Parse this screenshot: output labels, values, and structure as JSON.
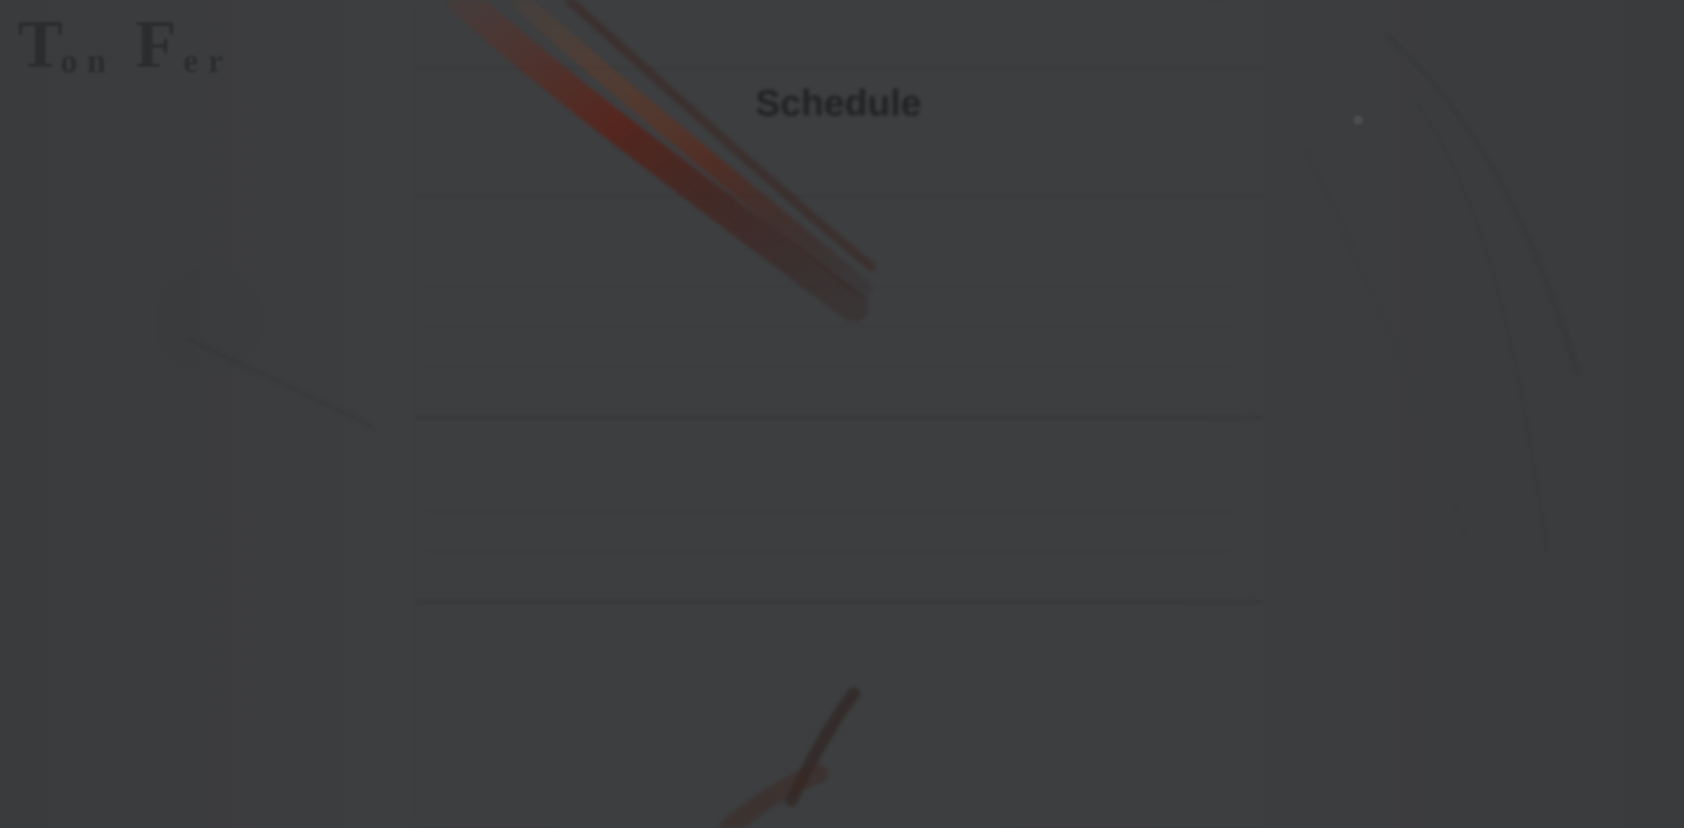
{
  "window": {
    "logo_text": "",
    "top_left_link": "",
    "top_right_link": ""
  },
  "schedule": {
    "title": "Schedule",
    "subtitle": "",
    "days": [
      {
        "name": "",
        "subtitle": "",
        "subtitle_accent": "",
        "rows": [
          {
            "label": "",
            "time": ""
          },
          {
            "label": "",
            "time": ""
          },
          {
            "label": "",
            "time": ""
          }
        ]
      },
      {
        "name": "",
        "subtitle": "",
        "subtitle_accent": "",
        "rows": [
          {
            "label": "",
            "time": ""
          },
          {
            "label": "",
            "time": ""
          }
        ]
      },
      {
        "name": "",
        "subtitle": "",
        "subtitle_accent": "",
        "rows": [
          {
            "label": "",
            "time": ""
          },
          {
            "label": "",
            "time": ""
          },
          {
            "label": "",
            "time": ""
          }
        ]
      }
    ]
  },
  "colors": {
    "overlay": "#3b3c3e",
    "accent": "#5a3626",
    "text_dark": "#1c1d1e"
  }
}
